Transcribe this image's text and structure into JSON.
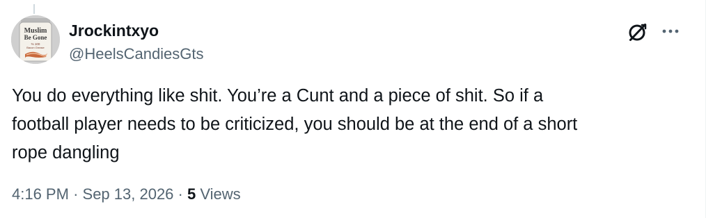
{
  "author": {
    "display_name": "Jrockintxyo",
    "handle": "@HeelsCandiesGts",
    "avatar_text": [
      "Muslim",
      "Be Gone",
      "% 100",
      "Bacon Grease"
    ]
  },
  "tweet": {
    "lines": [
      "You do everything like shit. You’re a Cunt and a piece of shit. So if a",
      "football player needs to be criticized, you should be at the end of a short",
      "rope dangling"
    ]
  },
  "meta": {
    "time": "4:16 PM",
    "separator": "·",
    "date": "Sep 13, 2026",
    "views_count": "5",
    "views_label": "Views"
  },
  "icons": {
    "grok": "grok-icon",
    "more": "more-options-icon"
  },
  "colors": {
    "text_primary": "#0f1419",
    "text_secondary": "#536471",
    "background": "#ffffff"
  }
}
